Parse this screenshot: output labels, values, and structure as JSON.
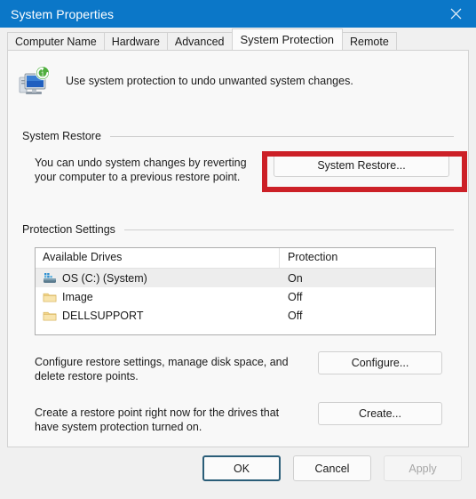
{
  "window": {
    "title": "System Properties",
    "close_icon": "close-icon",
    "titlebar_color": "#0b77c8"
  },
  "tabs": [
    {
      "label": "Computer Name",
      "active": false
    },
    {
      "label": "Hardware",
      "active": false
    },
    {
      "label": "Advanced",
      "active": false
    },
    {
      "label": "System Protection",
      "active": true
    },
    {
      "label": "Remote",
      "active": false
    }
  ],
  "header": {
    "icon": "system-protection-icon",
    "description": "Use system protection to undo unwanted system changes."
  },
  "system_restore": {
    "group_label": "System Restore",
    "description_line1": "You can undo system changes by reverting",
    "description_line2": "your computer to a previous restore point.",
    "button_label": "System Restore...",
    "highlight_color": "#cc2027"
  },
  "protection_settings": {
    "group_label": "Protection Settings",
    "columns": [
      "Available Drives",
      "Protection"
    ],
    "rows": [
      {
        "drive": "OS (C:) (System)",
        "protection": "On",
        "icon": "hard-drive-icon",
        "selected": true
      },
      {
        "drive": "Image",
        "protection": "Off",
        "icon": "folder-icon",
        "selected": false
      },
      {
        "drive": "DELLSUPPORT",
        "protection": "Off",
        "icon": "folder-icon",
        "selected": false
      }
    ],
    "configure": {
      "description_line1": "Configure restore settings, manage disk space, and",
      "description_line2": "delete restore points.",
      "button_label": "Configure..."
    },
    "create": {
      "description_line1": "Create a restore point right now for the drives that",
      "description_line2": "have system protection turned on.",
      "button_label": "Create..."
    }
  },
  "footer": {
    "ok_label": "OK",
    "cancel_label": "Cancel",
    "apply_label": "Apply",
    "apply_disabled": true
  }
}
